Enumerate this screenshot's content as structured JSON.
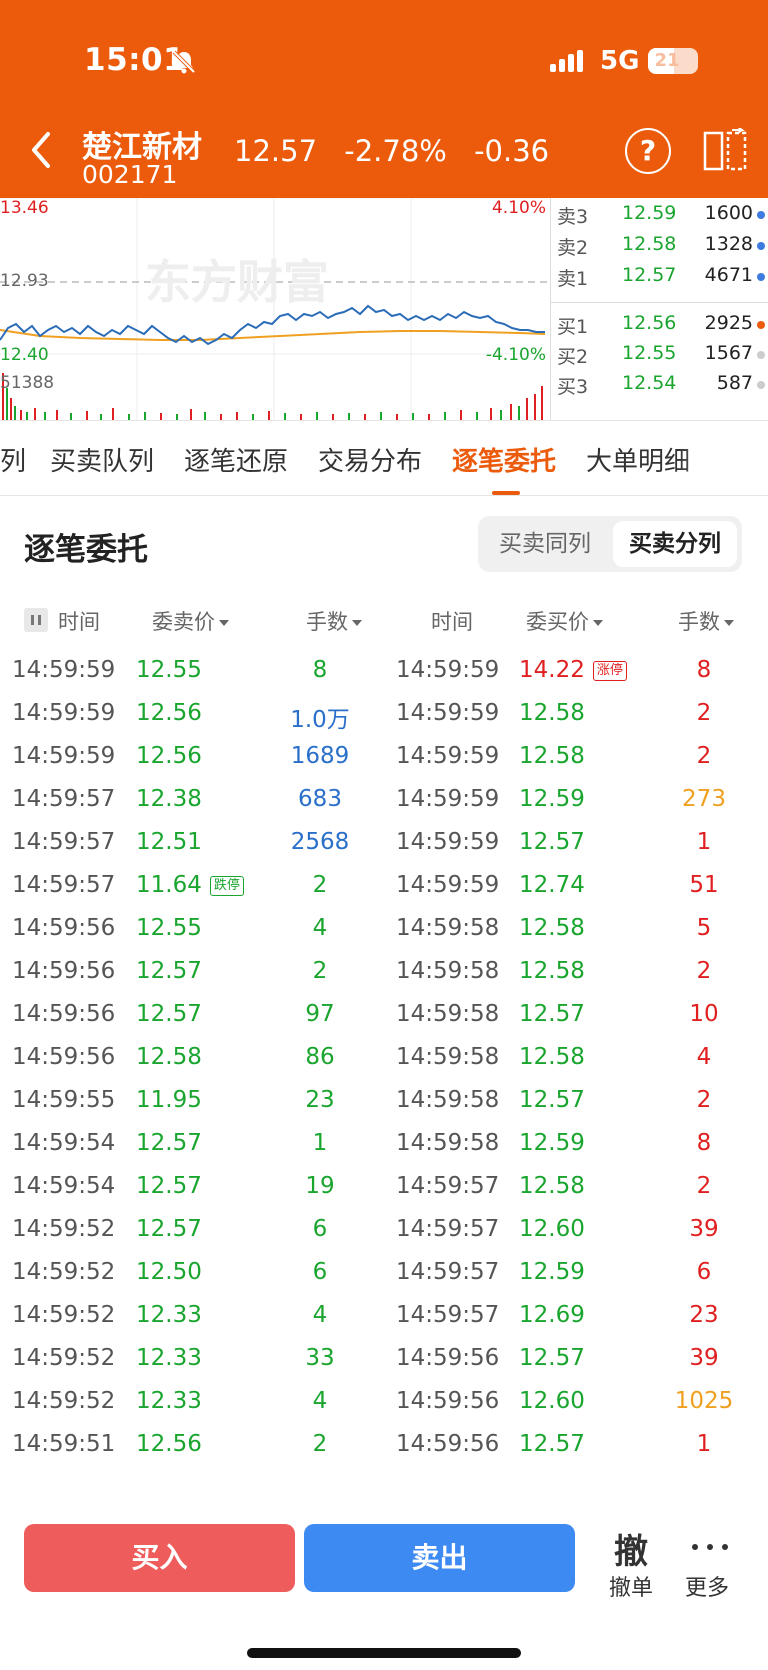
{
  "status_bar": {
    "time": "15:01",
    "network": "5G",
    "battery": "21"
  },
  "header": {
    "stock_name": "楚江新材",
    "stock_code": "002171",
    "price": "12.57",
    "change_pct": "-2.78%",
    "change": "-0.36",
    "help_glyph": "?"
  },
  "chart": {
    "price_high": "13.46",
    "price_prev_close": "12.93",
    "price_low": "12.40",
    "pct_high": "4.10%",
    "pct_low": "-4.10%",
    "volume_max": "51388",
    "watermark": "东方财富",
    "colors": {
      "price_line": "#2b6cb8",
      "avg_line": "#f0a020",
      "up": "#e02020",
      "down": "#1aa52f"
    }
  },
  "order_book": {
    "asks": [
      {
        "name": "卖3",
        "price": "12.59",
        "volume": "1600",
        "dot": "#3d7be0"
      },
      {
        "name": "卖2",
        "price": "12.58",
        "volume": "1328",
        "dot": "#3d7be0"
      },
      {
        "name": "卖1",
        "price": "12.57",
        "volume": "4671",
        "dot": "#3d7be0"
      }
    ],
    "bids": [
      {
        "name": "买1",
        "price": "12.56",
        "volume": "2925",
        "dot": "#ec5b0c"
      },
      {
        "name": "买2",
        "price": "12.55",
        "volume": "1567",
        "dot": "#cccccc"
      },
      {
        "name": "买3",
        "price": "12.54",
        "volume": "587",
        "dot": "#cccccc"
      }
    ]
  },
  "tabs": [
    {
      "label": "列",
      "active": false
    },
    {
      "label": "买卖队列",
      "active": false
    },
    {
      "label": "逐笔还原",
      "active": false
    },
    {
      "label": "交易分布",
      "active": false
    },
    {
      "label": "逐笔委托",
      "active": true
    },
    {
      "label": "大单明细",
      "active": false
    }
  ],
  "section": {
    "title": "逐笔委托",
    "toggle": [
      {
        "label": "买卖同列",
        "selected": false
      },
      {
        "label": "买卖分列",
        "selected": true
      }
    ]
  },
  "columns": {
    "sell_time": "时间",
    "sell_price": "委卖价",
    "sell_qty": "手数",
    "buy_time": "时间",
    "buy_price": "委买价",
    "buy_qty": "手数"
  },
  "rows": [
    {
      "t1": "14:59:59",
      "p1": "12.55",
      "v1": "8",
      "v1c": "#1aa52f",
      "t2": "14:59:59",
      "p2": "14.22",
      "p2c": "#e02020",
      "b2": "涨停",
      "v2": "8",
      "v2c": "#e02020"
    },
    {
      "t1": "14:59:59",
      "p1": "12.56",
      "v1": "1.0万",
      "v1c": "#2a6fc9",
      "t2": "14:59:59",
      "p2": "12.58",
      "p2c": "#1aa52f",
      "v2": "2",
      "v2c": "#e02020"
    },
    {
      "t1": "14:59:59",
      "p1": "12.56",
      "v1": "1689",
      "v1c": "#2a6fc9",
      "t2": "14:59:59",
      "p2": "12.58",
      "p2c": "#1aa52f",
      "v2": "2",
      "v2c": "#e02020"
    },
    {
      "t1": "14:59:57",
      "p1": "12.38",
      "v1": "683",
      "v1c": "#2a6fc9",
      "t2": "14:59:59",
      "p2": "12.59",
      "p2c": "#1aa52f",
      "v2": "273",
      "v2c": "#f0a020"
    },
    {
      "t1": "14:59:57",
      "p1": "12.51",
      "v1": "2568",
      "v1c": "#2a6fc9",
      "t2": "14:59:59",
      "p2": "12.57",
      "p2c": "#1aa52f",
      "v2": "1",
      "v2c": "#e02020"
    },
    {
      "t1": "14:59:57",
      "p1": "11.64",
      "b1": "跌停",
      "v1": "2",
      "v1c": "#1aa52f",
      "t2": "14:59:59",
      "p2": "12.74",
      "p2c": "#1aa52f",
      "v2": "51",
      "v2c": "#e02020"
    },
    {
      "t1": "14:59:56",
      "p1": "12.55",
      "v1": "4",
      "v1c": "#1aa52f",
      "t2": "14:59:58",
      "p2": "12.58",
      "p2c": "#1aa52f",
      "v2": "5",
      "v2c": "#e02020"
    },
    {
      "t1": "14:59:56",
      "p1": "12.57",
      "v1": "2",
      "v1c": "#1aa52f",
      "t2": "14:59:58",
      "p2": "12.58",
      "p2c": "#1aa52f",
      "v2": "2",
      "v2c": "#e02020"
    },
    {
      "t1": "14:59:56",
      "p1": "12.57",
      "v1": "97",
      "v1c": "#1aa52f",
      "t2": "14:59:58",
      "p2": "12.57",
      "p2c": "#1aa52f",
      "v2": "10",
      "v2c": "#e02020"
    },
    {
      "t1": "14:59:56",
      "p1": "12.58",
      "v1": "86",
      "v1c": "#1aa52f",
      "t2": "14:59:58",
      "p2": "12.58",
      "p2c": "#1aa52f",
      "v2": "4",
      "v2c": "#e02020"
    },
    {
      "t1": "14:59:55",
      "p1": "11.95",
      "v1": "23",
      "v1c": "#1aa52f",
      "t2": "14:59:58",
      "p2": "12.57",
      "p2c": "#1aa52f",
      "v2": "2",
      "v2c": "#e02020"
    },
    {
      "t1": "14:59:54",
      "p1": "12.57",
      "v1": "1",
      "v1c": "#1aa52f",
      "t2": "14:59:58",
      "p2": "12.59",
      "p2c": "#1aa52f",
      "v2": "8",
      "v2c": "#e02020"
    },
    {
      "t1": "14:59:54",
      "p1": "12.57",
      "v1": "19",
      "v1c": "#1aa52f",
      "t2": "14:59:57",
      "p2": "12.58",
      "p2c": "#1aa52f",
      "v2": "2",
      "v2c": "#e02020"
    },
    {
      "t1": "14:59:52",
      "p1": "12.57",
      "v1": "6",
      "v1c": "#1aa52f",
      "t2": "14:59:57",
      "p2": "12.60",
      "p2c": "#1aa52f",
      "v2": "39",
      "v2c": "#e02020"
    },
    {
      "t1": "14:59:52",
      "p1": "12.50",
      "v1": "6",
      "v1c": "#1aa52f",
      "t2": "14:59:57",
      "p2": "12.59",
      "p2c": "#1aa52f",
      "v2": "6",
      "v2c": "#e02020"
    },
    {
      "t1": "14:59:52",
      "p1": "12.33",
      "v1": "4",
      "v1c": "#1aa52f",
      "t2": "14:59:57",
      "p2": "12.69",
      "p2c": "#1aa52f",
      "v2": "23",
      "v2c": "#e02020"
    },
    {
      "t1": "14:59:52",
      "p1": "12.33",
      "v1": "33",
      "v1c": "#1aa52f",
      "t2": "14:59:56",
      "p2": "12.57",
      "p2c": "#1aa52f",
      "v2": "39",
      "v2c": "#e02020"
    },
    {
      "t1": "14:59:52",
      "p1": "12.33",
      "v1": "4",
      "v1c": "#1aa52f",
      "t2": "14:59:56",
      "p2": "12.60",
      "p2c": "#1aa52f",
      "v2": "1025",
      "v2c": "#f0a020"
    },
    {
      "t1": "14:59:51",
      "p1": "12.56",
      "v1": "2",
      "v1c": "#1aa52f",
      "t2": "14:59:56",
      "p2": "12.57",
      "p2c": "#1aa52f",
      "v2": "1",
      "v2c": "#e02020"
    }
  ],
  "bottom_bar": {
    "buy_label": "买入",
    "sell_label": "卖出",
    "cancel_glyph": "撤",
    "cancel_label": "撤单",
    "more_label": "更多"
  }
}
